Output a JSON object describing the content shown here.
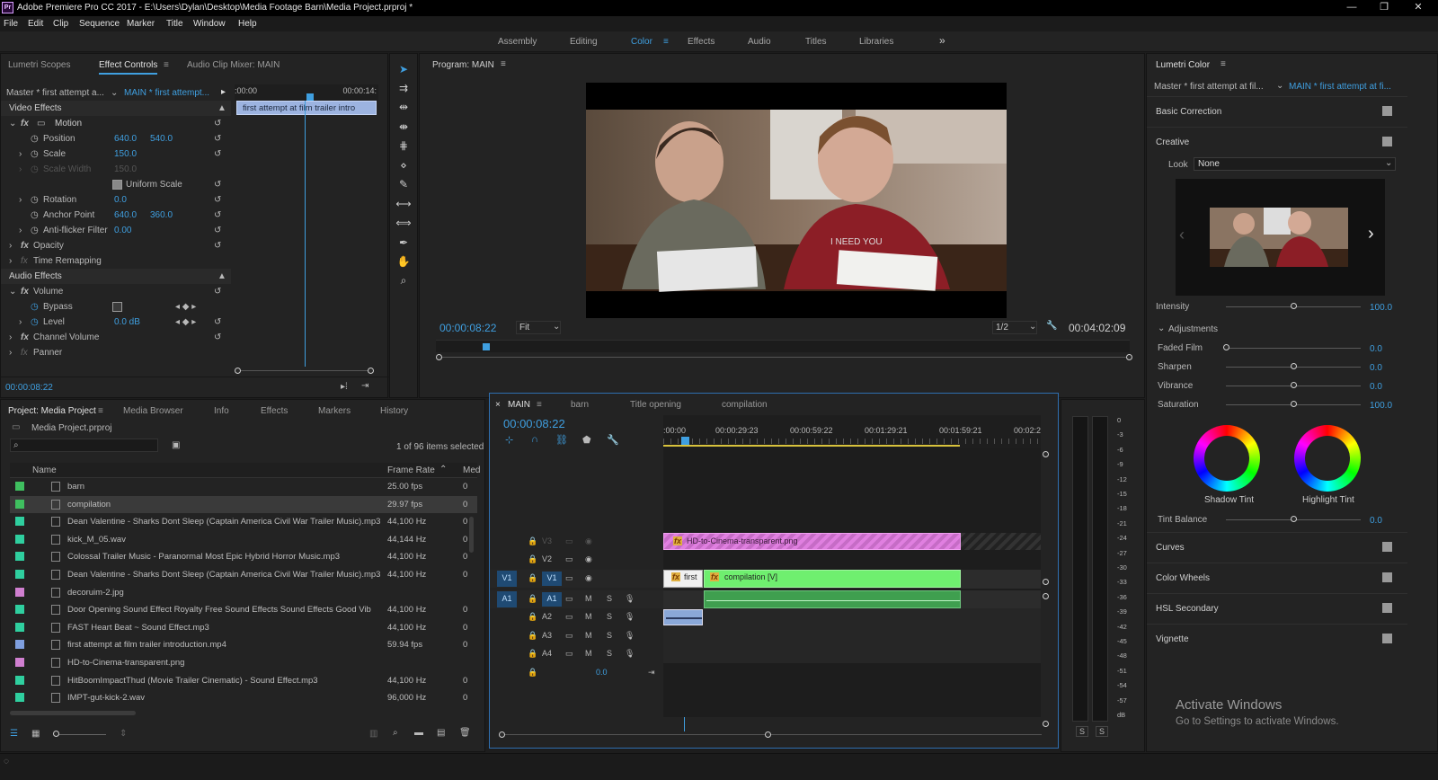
{
  "app": {
    "logo": "Pr",
    "title": "Adobe Premiere Pro CC 2017 - E:\\Users\\Dylan\\Desktop\\Media Footage Barn\\Media Project.prproj *",
    "win": [
      "—",
      "❐",
      "✕"
    ]
  },
  "menu": [
    "File",
    "Edit",
    "Clip",
    "Sequence",
    "Marker",
    "Title",
    "Window",
    "Help"
  ],
  "workspaces": [
    "Assembly",
    "Editing",
    "Color",
    "Effects",
    "Audio",
    "Titles",
    "Libraries"
  ],
  "workspace_active": "Color",
  "ws_more": "»",
  "effect_panel": {
    "tabs": [
      "Lumetri Scopes",
      "Effect Controls",
      "Audio Clip Mixer: MAIN"
    ],
    "master": "Master * first attempt a...",
    "seq": "MAIN * first attempt...",
    "tc_start": ":00:00",
    "tc_end": "00:00:14:",
    "clip": "first attempt at film trailer intro",
    "video_effects": "Video Effects",
    "motion": "Motion",
    "position": "Position",
    "pos_x": "640.0",
    "pos_y": "540.0",
    "scale": "Scale",
    "scale_v": "150.0",
    "scale_width": "Scale Width",
    "scale_width_v": "150.0",
    "uniform": "Uniform Scale",
    "rotation": "Rotation",
    "rotation_v": "0.0",
    "anchor": "Anchor Point",
    "anchor_x": "640.0",
    "anchor_y": "360.0",
    "antiflicker": "Anti-flicker Filter",
    "antiflicker_v": "0.00",
    "opacity": "Opacity",
    "time_remap": "Time Remapping",
    "audio_effects": "Audio Effects",
    "volume": "Volume",
    "bypass": "Bypass",
    "level": "Level",
    "level_v": "0.0 dB",
    "channel_volume": "Channel Volume",
    "panner": "Panner",
    "timecode": "00:00:08:22"
  },
  "program": {
    "title": "Program: MAIN",
    "timecode": "00:00:08:22",
    "fit": "Fit",
    "res": "1/2",
    "duration": "00:04:02:09"
  },
  "project": {
    "tabs": [
      "Project: Media Project",
      "Media Browser",
      "Info",
      "Effects",
      "Markers",
      "History"
    ],
    "path": "Media Project.prproj",
    "selected": "1 of 96 items selected",
    "col_name": "Name",
    "col_rate": "Frame Rate",
    "col_media": "Med",
    "items": [
      {
        "name": "barn",
        "rate": "25.00 fps",
        "m": "0",
        "color": "#3fbf5f"
      },
      {
        "name": "compilation",
        "rate": "29.97 fps",
        "m": "0",
        "color": "#3fbf5f"
      },
      {
        "name": "Dean Valentine - Sharks Dont Sleep (Captain America Civil War Trailer Music).mp3",
        "rate": "44,100 Hz",
        "m": "0",
        "color": "#2fcf9f"
      },
      {
        "name": "kick_M_05.wav",
        "rate": "44,144 Hz",
        "m": "0",
        "color": "#2fcf9f"
      },
      {
        "name": "Colossal Trailer Music - Paranormal  Most Epic Hybrid Horror Music.mp3",
        "rate": "44,100 Hz",
        "m": "0",
        "color": "#2fcf9f"
      },
      {
        "name": "Dean Valentine - Sharks Dont Sleep (Captain America Civil War Trailer Music).mp3",
        "rate": "44,100 Hz",
        "m": "0",
        "color": "#2fcf9f"
      },
      {
        "name": "decoruim-2.jpg",
        "rate": "",
        "m": "",
        "color": "#d07fd0"
      },
      {
        "name": "Door Opening Sound Effect  Royalty Free Sound Effects  Sound Effects  Good Vib",
        "rate": "44,100 Hz",
        "m": "0",
        "color": "#2fcf9f"
      },
      {
        "name": "FAST Heart Beat ~ Sound Effect.mp3",
        "rate": "44,100 Hz",
        "m": "0",
        "color": "#2fcf9f"
      },
      {
        "name": "first attempt at film trailer introduction.mp4",
        "rate": "59.94 fps",
        "m": "0",
        "color": "#7f9fdf"
      },
      {
        "name": "HD-to-Cinema-transparent.png",
        "rate": "",
        "m": "",
        "color": "#d07fd0"
      },
      {
        "name": "HitBoomImpactThud (Movie Trailer Cinematic) - Sound Effect.mp3",
        "rate": "44,100 Hz",
        "m": "0",
        "color": "#2fcf9f"
      },
      {
        "name": "IMPT-gut-kick-2.wav",
        "rate": "96,000 Hz",
        "m": "0",
        "color": "#2fcf9f"
      }
    ]
  },
  "timeline": {
    "tabs": [
      "MAIN",
      "barn",
      "Title opening",
      "compilation"
    ],
    "close": "×",
    "timecode": "00:00:08:22",
    "ruler": [
      ":00:00",
      "00:00:29:23",
      "00:00:59:22",
      "00:01:29:21",
      "00:01:59:21",
      "00:02:2"
    ],
    "tracks": [
      "V3",
      "V2",
      "V1",
      "A1",
      "A2",
      "A3",
      "A4"
    ],
    "src_v": "V1",
    "src_a": "A1",
    "m": "M",
    "s": "S",
    "clip_png": "HD-to-Cinema-transparent.png",
    "clip_first": "first",
    "clip_comp": "compilation [V]",
    "master_v": "0.0",
    "fx": "fx"
  },
  "meter": {
    "scale": [
      "0",
      "-3",
      "-6",
      "-9",
      "-12",
      "-15",
      "-18",
      "-21",
      "-24",
      "-27",
      "-30",
      "-33",
      "-36",
      "-39",
      "-42",
      "-45",
      "-48",
      "-51",
      "-54",
      "-57",
      "dB"
    ],
    "solo": [
      "S",
      "S"
    ]
  },
  "lumetri": {
    "title": "Lumetri Color",
    "master": "Master * first attempt at fil...",
    "seq": "MAIN * first attempt at fi...",
    "basic": "Basic Correction",
    "creative": "Creative",
    "look_label": "Look",
    "look_value": "None",
    "intensity": "Intensity",
    "intensity_v": "100.0",
    "adjustments": "Adjustments",
    "faded": "Faded Film",
    "faded_v": "0.0",
    "sharpen": "Sharpen",
    "sharpen_v": "0.0",
    "vibrance": "Vibrance",
    "vibrance_v": "0.0",
    "saturation": "Saturation",
    "saturation_v": "100.0",
    "shadow": "Shadow Tint",
    "highlight": "Highlight Tint",
    "tint_balance": "Tint Balance",
    "tint_balance_v": "0.0",
    "curves": "Curves",
    "wheels": "Color Wheels",
    "hsl": "HSL Secondary",
    "vignette": "Vignette"
  },
  "watermark": {
    "title": "Activate Windows",
    "sub": "Go to Settings to activate Windows."
  },
  "colors": {
    "accent": "#3f9fe0",
    "clip_green": "#6fef6f",
    "clip_pink": "#e07fe0",
    "audio_green": "#3f9f4f"
  }
}
